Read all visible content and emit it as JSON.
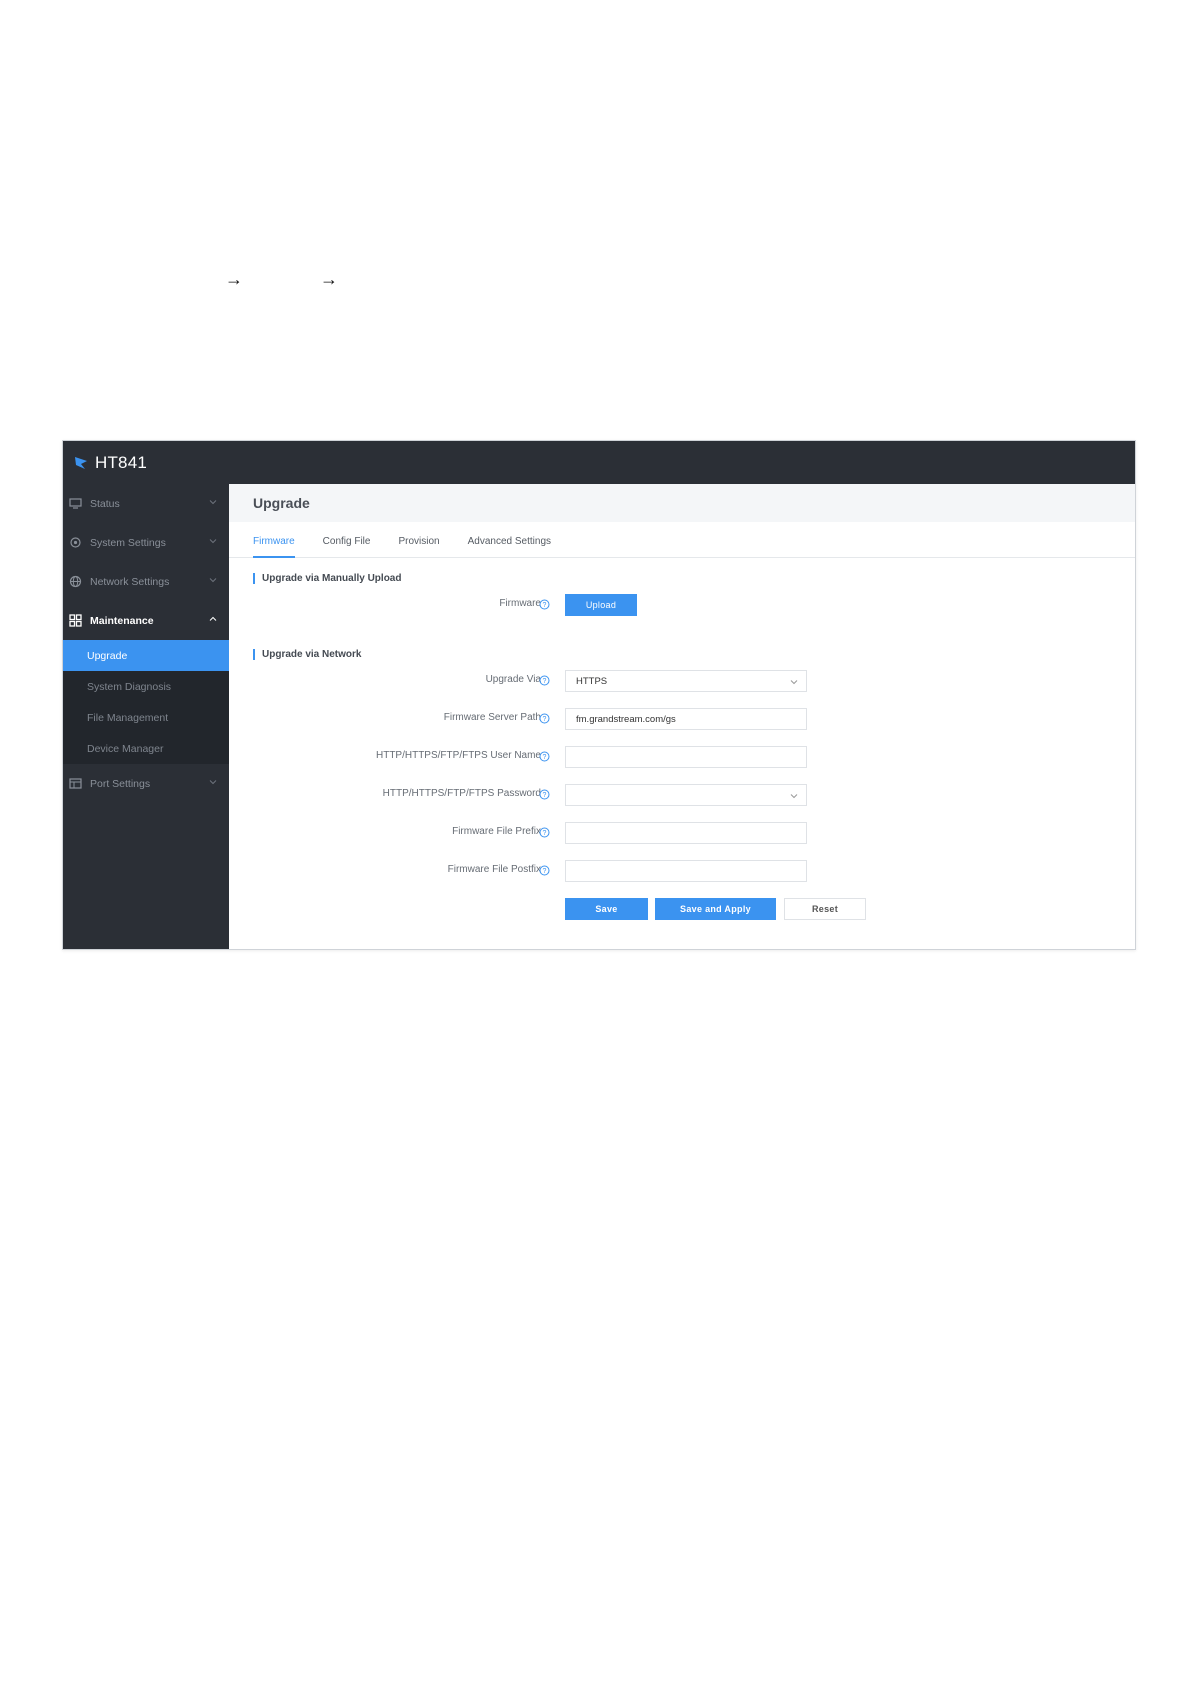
{
  "app": {
    "brand": "HT841"
  },
  "sidebar": {
    "items": [
      {
        "label": "Status"
      },
      {
        "label": "System Settings"
      },
      {
        "label": "Network Settings"
      },
      {
        "label": "Maintenance"
      },
      {
        "label": "Port Settings"
      }
    ],
    "maintenance_sub": [
      {
        "label": "Upgrade"
      },
      {
        "label": "System Diagnosis"
      },
      {
        "label": "File Management"
      },
      {
        "label": "Device Manager"
      }
    ]
  },
  "page": {
    "title": "Upgrade"
  },
  "tabs": [
    {
      "label": "Firmware"
    },
    {
      "label": "Config File"
    },
    {
      "label": "Provision"
    },
    {
      "label": "Advanced Settings"
    }
  ],
  "manual": {
    "section_title": "Upgrade via Manually Upload",
    "firmware_label": "Firmware",
    "upload_label": "Upload"
  },
  "network": {
    "section_title": "Upgrade via Network",
    "upgrade_via_label": "Upgrade Via",
    "upgrade_via_value": "HTTPS",
    "server_path_label": "Firmware Server Path",
    "server_path_value": "fm.grandstream.com/gs",
    "user_label": "HTTP/HTTPS/FTP/FTPS User Name",
    "user_value": "",
    "password_label": "HTTP/HTTPS/FTP/FTPS Password",
    "password_value": "",
    "prefix_label": "Firmware File Prefix",
    "prefix_value": "",
    "postfix_label": "Firmware File Postfix",
    "postfix_value": ""
  },
  "actions": {
    "save": "Save",
    "save_apply": "Save and Apply",
    "reset": "Reset"
  },
  "colors": {
    "accent": "#3b93f0",
    "sidebar_bg": "#2b2f36"
  },
  "icons": [
    "arrow-right-icon",
    "grandstream-logo-icon",
    "monitor-icon",
    "gear-icon",
    "globe-icon",
    "grid-icon",
    "port-icon",
    "chevron-down-icon",
    "chevron-up-icon",
    "help-circle-icon"
  ]
}
